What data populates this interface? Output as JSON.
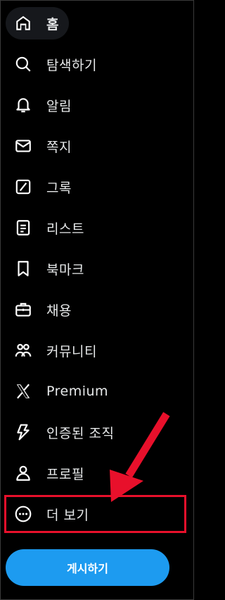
{
  "nav": {
    "items": [
      {
        "label": "홈",
        "icon": "home-icon"
      },
      {
        "label": "탐색하기",
        "icon": "search-icon"
      },
      {
        "label": "알림",
        "icon": "bell-icon"
      },
      {
        "label": "쪽지",
        "icon": "mail-icon"
      },
      {
        "label": "그록",
        "icon": "grok-icon"
      },
      {
        "label": "리스트",
        "icon": "list-icon"
      },
      {
        "label": "북마크",
        "icon": "bookmark-icon"
      },
      {
        "label": "채용",
        "icon": "briefcase-icon"
      },
      {
        "label": "커뮤니티",
        "icon": "people-icon"
      },
      {
        "label": "Premium",
        "icon": "x-logo-icon"
      },
      {
        "label": "인증된 조직",
        "icon": "lightning-icon"
      },
      {
        "label": "프로필",
        "icon": "person-icon"
      },
      {
        "label": "더 보기",
        "icon": "more-circle-icon"
      }
    ]
  },
  "post_button": {
    "label": "게시하기"
  },
  "colors": {
    "background": "#000000",
    "accent": "#1d9bf0",
    "annotation": "#e8102b",
    "text": "#e7e9ea"
  }
}
